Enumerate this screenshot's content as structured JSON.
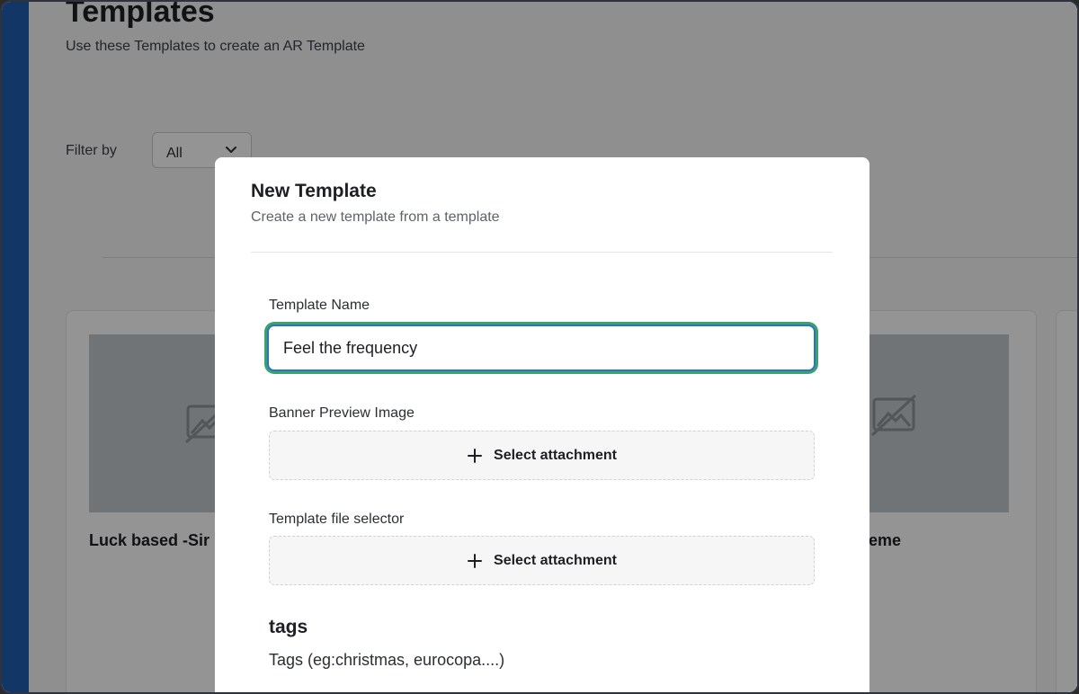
{
  "page": {
    "title": "Templates",
    "subtitle": "Use these Templates to create an AR Template",
    "filter_label": "Filter by",
    "filter_value": "All"
  },
  "cards": [
    {
      "title": "Luck based -Sir"
    },
    {
      "title": "eme"
    }
  ],
  "modal": {
    "title": "New Template",
    "subtitle": "Create a new template from a template",
    "template_name_label": "Template Name",
    "template_name_value": "Feel the frequency",
    "banner_label": "Banner Preview Image",
    "banner_button": "Select attachment",
    "file_label": "Template file selector",
    "file_button": "Select attachment",
    "tags_heading": "tags",
    "tags_hint": "Tags (eg:christmas, eurocopa....)"
  },
  "colors": {
    "sidebar": "#1f5fb0",
    "focus_ring": "#3aa36a",
    "input_border": "#2f6fd0"
  },
  "icons": [
    "chevron-down-icon",
    "image-placeholder-icon",
    "plus-icon"
  ]
}
